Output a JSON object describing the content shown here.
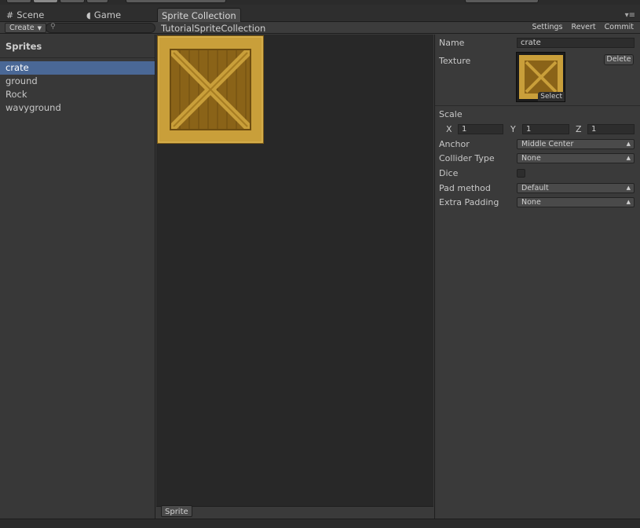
{
  "tabs": [
    {
      "label": "Scene",
      "icon": "grid-icon"
    },
    {
      "label": "Game",
      "icon": "pacman-icon"
    },
    {
      "label": "Sprite Collection",
      "active": true
    }
  ],
  "toolbar": {
    "create_label": "Create",
    "search_placeholder": "",
    "collection_name": "TutorialSpriteCollection",
    "settings_label": "Settings",
    "revert_label": "Revert",
    "commit_label": "Commit"
  },
  "sprites_panel": {
    "title": "Sprites",
    "items": [
      {
        "label": "crate",
        "selected": true
      },
      {
        "label": "ground"
      },
      {
        "label": "Rock"
      },
      {
        "label": "wavyground"
      }
    ]
  },
  "preview": {
    "tab_label": "Sprite"
  },
  "inspector": {
    "name_label": "Name",
    "name_value": "crate",
    "texture_label": "Texture",
    "delete_label": "Delete",
    "select_label": "Select",
    "scale_label": "Scale",
    "scale": {
      "x_label": "X",
      "x": "1",
      "y_label": "Y",
      "y": "1",
      "z_label": "Z",
      "z": "1"
    },
    "anchor_label": "Anchor",
    "anchor_value": "Middle Center",
    "collider_label": "Collider Type",
    "collider_value": "None",
    "dice_label": "Dice",
    "dice_checked": false,
    "pad_label": "Pad method",
    "pad_value": "Default",
    "extra_padding_label": "Extra Padding",
    "extra_padding_value": "None"
  },
  "colors": {
    "selection": "#4a6896",
    "crate": "#c99f3a",
    "crate_dark": "#8a6318"
  }
}
